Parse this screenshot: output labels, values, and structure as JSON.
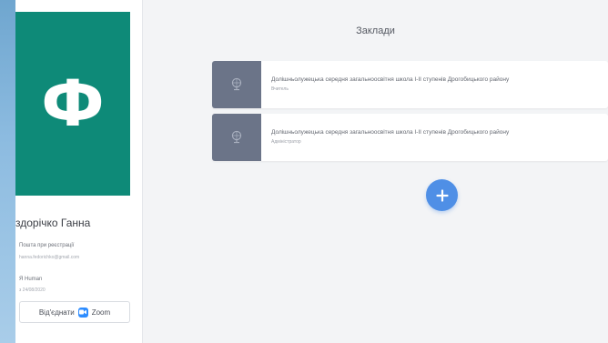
{
  "profile": {
    "avatar_letter": "Ф",
    "avatar_color": "#0e8a78",
    "name": "здорічко Ганна",
    "email_label": "Пошта при реєстрації",
    "email_value": "hanna.fedorichko@gmail.com",
    "human_label": "Я Human",
    "human_value": "з 24/08/2020",
    "disconnect_label": "Від'єднати",
    "zoom_label": "Zoom"
  },
  "main": {
    "title": "Заклади",
    "schools": [
      {
        "name": "Долішньолужецька середня загальноосвітня школа І-ІІ ступенів Дрогобицького району",
        "role": "Вчитель"
      },
      {
        "name": "Долішньолужецька середня загальноосвітня школа І-ІІ ступенів Дрогобицького району",
        "role": "Адміністратор"
      }
    ],
    "add_icon": "plus-icon"
  },
  "colors": {
    "accent": "#4f8fe6",
    "thumb": "#6b7488",
    "zoom": "#2d8cff"
  }
}
